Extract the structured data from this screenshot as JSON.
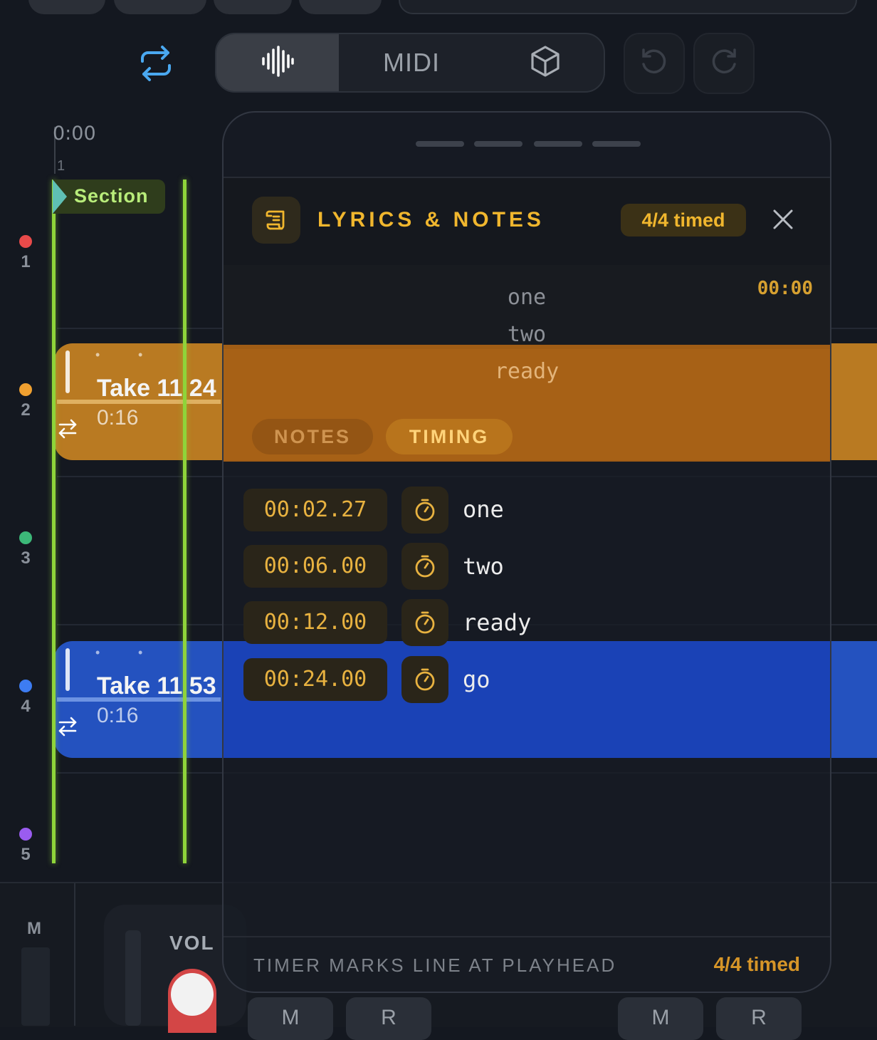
{
  "toolbar": {
    "modes": [
      {
        "id": "audio",
        "icon": "waveform-icon",
        "selected": true
      },
      {
        "id": "midi",
        "label": "MIDI"
      },
      {
        "id": "3d",
        "icon": "cube-icon"
      }
    ],
    "icons": [
      "loop-icon",
      "undo-icon",
      "redo-icon"
    ],
    "accent": "#4aa8f0"
  },
  "ruler": {
    "time": "0:00",
    "bar": "1"
  },
  "tracks": [
    {
      "number": "1",
      "color": "#e84a4a"
    },
    {
      "number": "2",
      "color": "#f0a030"
    },
    {
      "number": "3",
      "color": "#3cb878"
    },
    {
      "number": "4",
      "color": "#3d7cf2"
    },
    {
      "number": "5",
      "color": "#9a5cf0"
    }
  ],
  "section_marker": {
    "label": "Section",
    "color": "#8fd43a"
  },
  "clips": [
    {
      "title": "Take 11 24",
      "duration": "0:16",
      "color": "#b97a22"
    },
    {
      "title": "Take 11 53",
      "duration": "0:16",
      "color": "#2452bf"
    }
  ],
  "mixer": {
    "mute_label": "M",
    "vol_label": "VOL",
    "buttons": [
      "M",
      "R",
      "M",
      "R"
    ]
  },
  "panel": {
    "title": "LYRICS & NOTES",
    "badge": "4/4 timed",
    "preview": {
      "time": "00:00",
      "lines": [
        "one",
        "two",
        "ready"
      ]
    },
    "tabs": [
      {
        "label": "NOTES",
        "selected": false
      },
      {
        "label": "TIMING",
        "selected": true
      }
    ],
    "timing_rows": [
      {
        "time": "00:02.27",
        "text": "one"
      },
      {
        "time": "00:06.00",
        "text": "two"
      },
      {
        "time": "00:12.00",
        "text": "ready"
      },
      {
        "time": "00:24.00",
        "text": "go"
      }
    ],
    "footer": {
      "hint": "TIMER MARKS LINE AT PLAYHEAD",
      "status": "4/4 timed"
    },
    "accent": "#f0b62e"
  }
}
